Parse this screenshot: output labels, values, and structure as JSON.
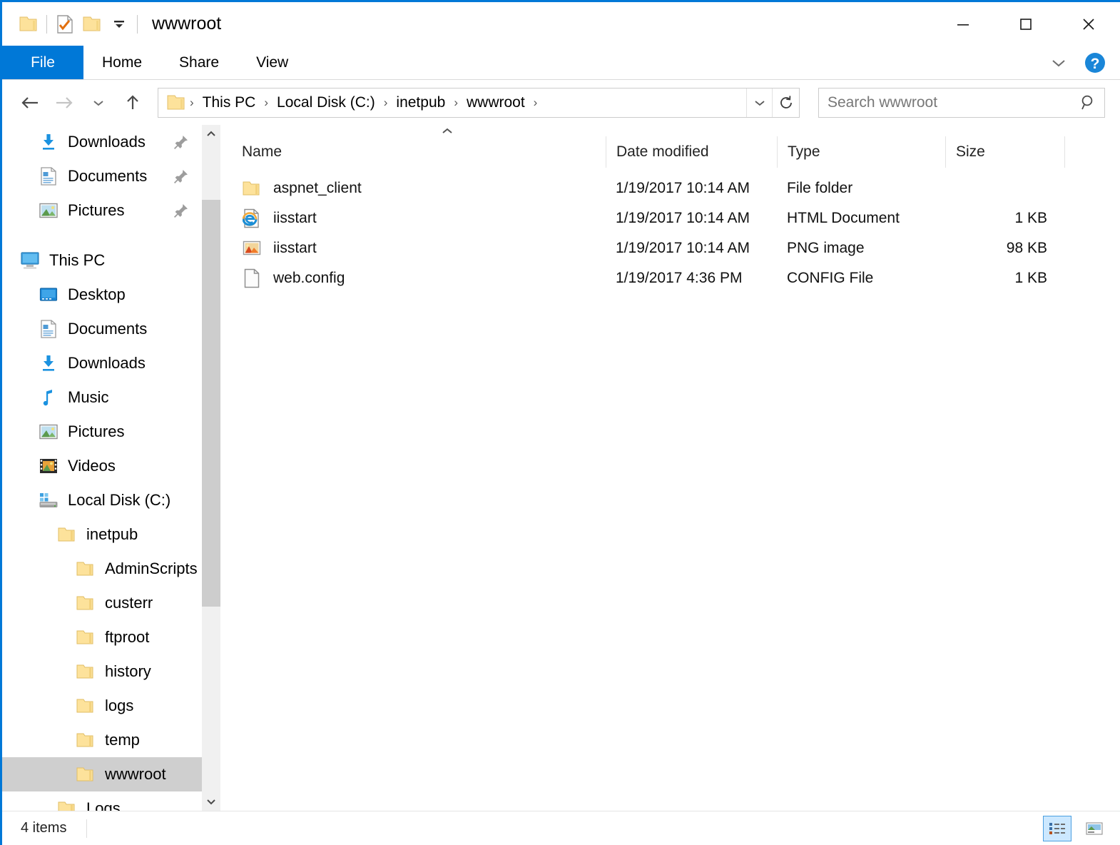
{
  "window": {
    "title": "wwwroot",
    "accent_color": "#0078d7",
    "selection_color": "#cfcfcf"
  },
  "quick_access": [
    {
      "name": "folder-icon",
      "label": "Folder"
    },
    {
      "name": "properties-icon",
      "label": "Properties"
    },
    {
      "name": "new-folder-icon",
      "label": "New folder"
    },
    {
      "name": "customize-dropdown-icon",
      "label": "Customize Quick Access Toolbar"
    }
  ],
  "window_controls": {
    "minimize": "—",
    "maximize": "□",
    "close": "✕"
  },
  "ribbon": {
    "tabs": [
      {
        "label": "File",
        "active": true
      },
      {
        "label": "Home",
        "active": false
      },
      {
        "label": "Share",
        "active": false
      },
      {
        "label": "View",
        "active": false
      }
    ],
    "expand_label": "Expand the Ribbon",
    "help_label": "Help"
  },
  "navigation": {
    "back_label": "Back",
    "forward_label": "Forward",
    "recent_label": "Recent locations",
    "up_label": "Up to Local Disk (C:)\\inetpub",
    "refresh_label": "Refresh",
    "breadcrumbs": [
      "This PC",
      "Local Disk (C:)",
      "inetpub",
      "wwwroot"
    ],
    "separator": "›",
    "dropdown_label": "Previous Locations"
  },
  "search": {
    "placeholder": "Search wwwroot",
    "value": ""
  },
  "sidebar": {
    "items": [
      {
        "label": "Downloads",
        "icon": "downloads-icon",
        "indent": 1,
        "pinned": true,
        "selected": false
      },
      {
        "label": "Documents",
        "icon": "documents-icon",
        "indent": 1,
        "pinned": true,
        "selected": false
      },
      {
        "label": "Pictures",
        "icon": "pictures-icon",
        "indent": 1,
        "pinned": true,
        "selected": false
      },
      {
        "label": "This PC",
        "icon": "this-pc-icon",
        "indent": 0,
        "pinned": false,
        "selected": false
      },
      {
        "label": "Desktop",
        "icon": "desktop-icon",
        "indent": 1,
        "pinned": false,
        "selected": false
      },
      {
        "label": "Documents",
        "icon": "documents-icon",
        "indent": 1,
        "pinned": false,
        "selected": false
      },
      {
        "label": "Downloads",
        "icon": "downloads-icon",
        "indent": 1,
        "pinned": false,
        "selected": false
      },
      {
        "label": "Music",
        "icon": "music-icon",
        "indent": 1,
        "pinned": false,
        "selected": false
      },
      {
        "label": "Pictures",
        "icon": "pictures-icon",
        "indent": 1,
        "pinned": false,
        "selected": false
      },
      {
        "label": "Videos",
        "icon": "videos-icon",
        "indent": 1,
        "pinned": false,
        "selected": false
      },
      {
        "label": "Local Disk (C:)",
        "icon": "hard-drive-icon",
        "indent": 1,
        "pinned": false,
        "selected": false
      },
      {
        "label": "inetpub",
        "icon": "folder-icon",
        "indent": 2,
        "pinned": false,
        "selected": false
      },
      {
        "label": "AdminScripts",
        "icon": "folder-icon",
        "indent": 3,
        "pinned": false,
        "selected": false
      },
      {
        "label": "custerr",
        "icon": "folder-icon",
        "indent": 3,
        "pinned": false,
        "selected": false
      },
      {
        "label": "ftproot",
        "icon": "folder-icon",
        "indent": 3,
        "pinned": false,
        "selected": false
      },
      {
        "label": "history",
        "icon": "folder-icon",
        "indent": 3,
        "pinned": false,
        "selected": false
      },
      {
        "label": "logs",
        "icon": "folder-icon",
        "indent": 3,
        "pinned": false,
        "selected": false
      },
      {
        "label": "temp",
        "icon": "folder-icon",
        "indent": 3,
        "pinned": false,
        "selected": false
      },
      {
        "label": "wwwroot",
        "icon": "folder-icon",
        "indent": 3,
        "pinned": false,
        "selected": true
      },
      {
        "label": "Logs",
        "icon": "folder-icon",
        "indent": 2,
        "pinned": false,
        "selected": false
      }
    ]
  },
  "file_list": {
    "sort_column": "Name",
    "sort_direction": "ascending",
    "columns": [
      {
        "label": "Name",
        "key": "name"
      },
      {
        "label": "Date modified",
        "key": "date"
      },
      {
        "label": "Type",
        "key": "type"
      },
      {
        "label": "Size",
        "key": "size"
      }
    ],
    "rows": [
      {
        "name": "aspnet_client",
        "date": "1/19/2017 10:14 AM",
        "type": "File folder",
        "size": "",
        "icon": "folder-icon"
      },
      {
        "name": "iisstart",
        "date": "1/19/2017 10:14 AM",
        "type": "HTML Document",
        "size": "1 KB",
        "icon": "html-document-icon"
      },
      {
        "name": "iisstart",
        "date": "1/19/2017 10:14 AM",
        "type": "PNG image",
        "size": "98 KB",
        "icon": "png-image-icon"
      },
      {
        "name": "web.config",
        "date": "1/19/2017 4:36 PM",
        "type": "CONFIG File",
        "size": "1 KB",
        "icon": "generic-file-icon"
      }
    ]
  },
  "status_bar": {
    "item_count": "4 items",
    "views": [
      {
        "name": "details-view-button",
        "label": "Details view",
        "active": true
      },
      {
        "name": "large-icons-view-button",
        "label": "Large icons view",
        "active": false
      }
    ]
  }
}
